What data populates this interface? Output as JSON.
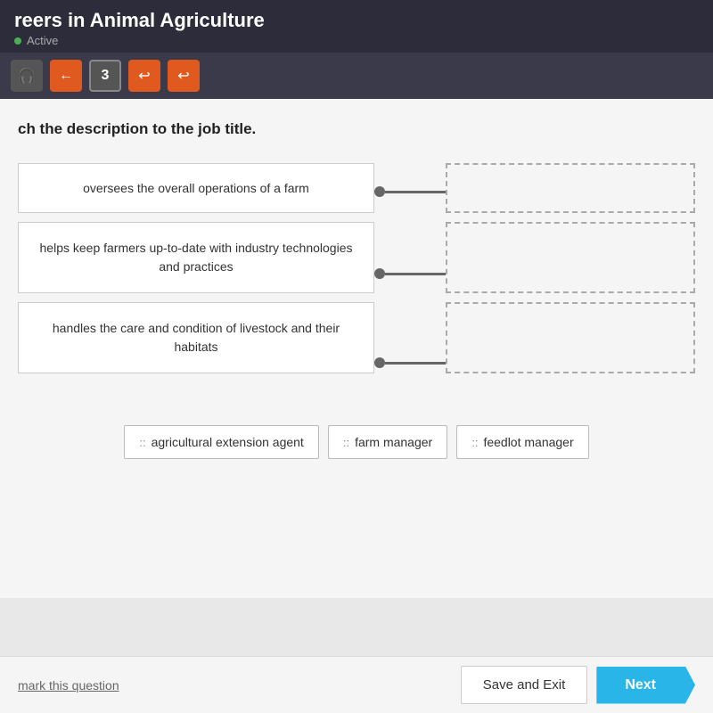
{
  "header": {
    "title": "reers in Animal Agriculture",
    "status_label": "Active"
  },
  "toolbar": {
    "back_label": "←",
    "counter": "3",
    "undo_label": "↩",
    "redo_label": "↩"
  },
  "instruction": "ch the description to the job title.",
  "descriptions": [
    {
      "id": "desc1",
      "text": "oversees the overall operations of a farm"
    },
    {
      "id": "desc2",
      "text": "helps keep farmers up-to-date with industry technologies and practices"
    },
    {
      "id": "desc3",
      "text": "handles the care and condition of livestock and their habitats"
    }
  ],
  "answer_chips": [
    {
      "id": "chip1",
      "label": "agricultural extension agent",
      "icon": "::"
    },
    {
      "id": "chip2",
      "label": "farm manager",
      "icon": "::"
    },
    {
      "id": "chip3",
      "label": "feedlot manager",
      "icon": "::"
    }
  ],
  "footer": {
    "mark_question_label": "mark this question",
    "save_exit_label": "Save and Exit",
    "next_label": "Next"
  }
}
